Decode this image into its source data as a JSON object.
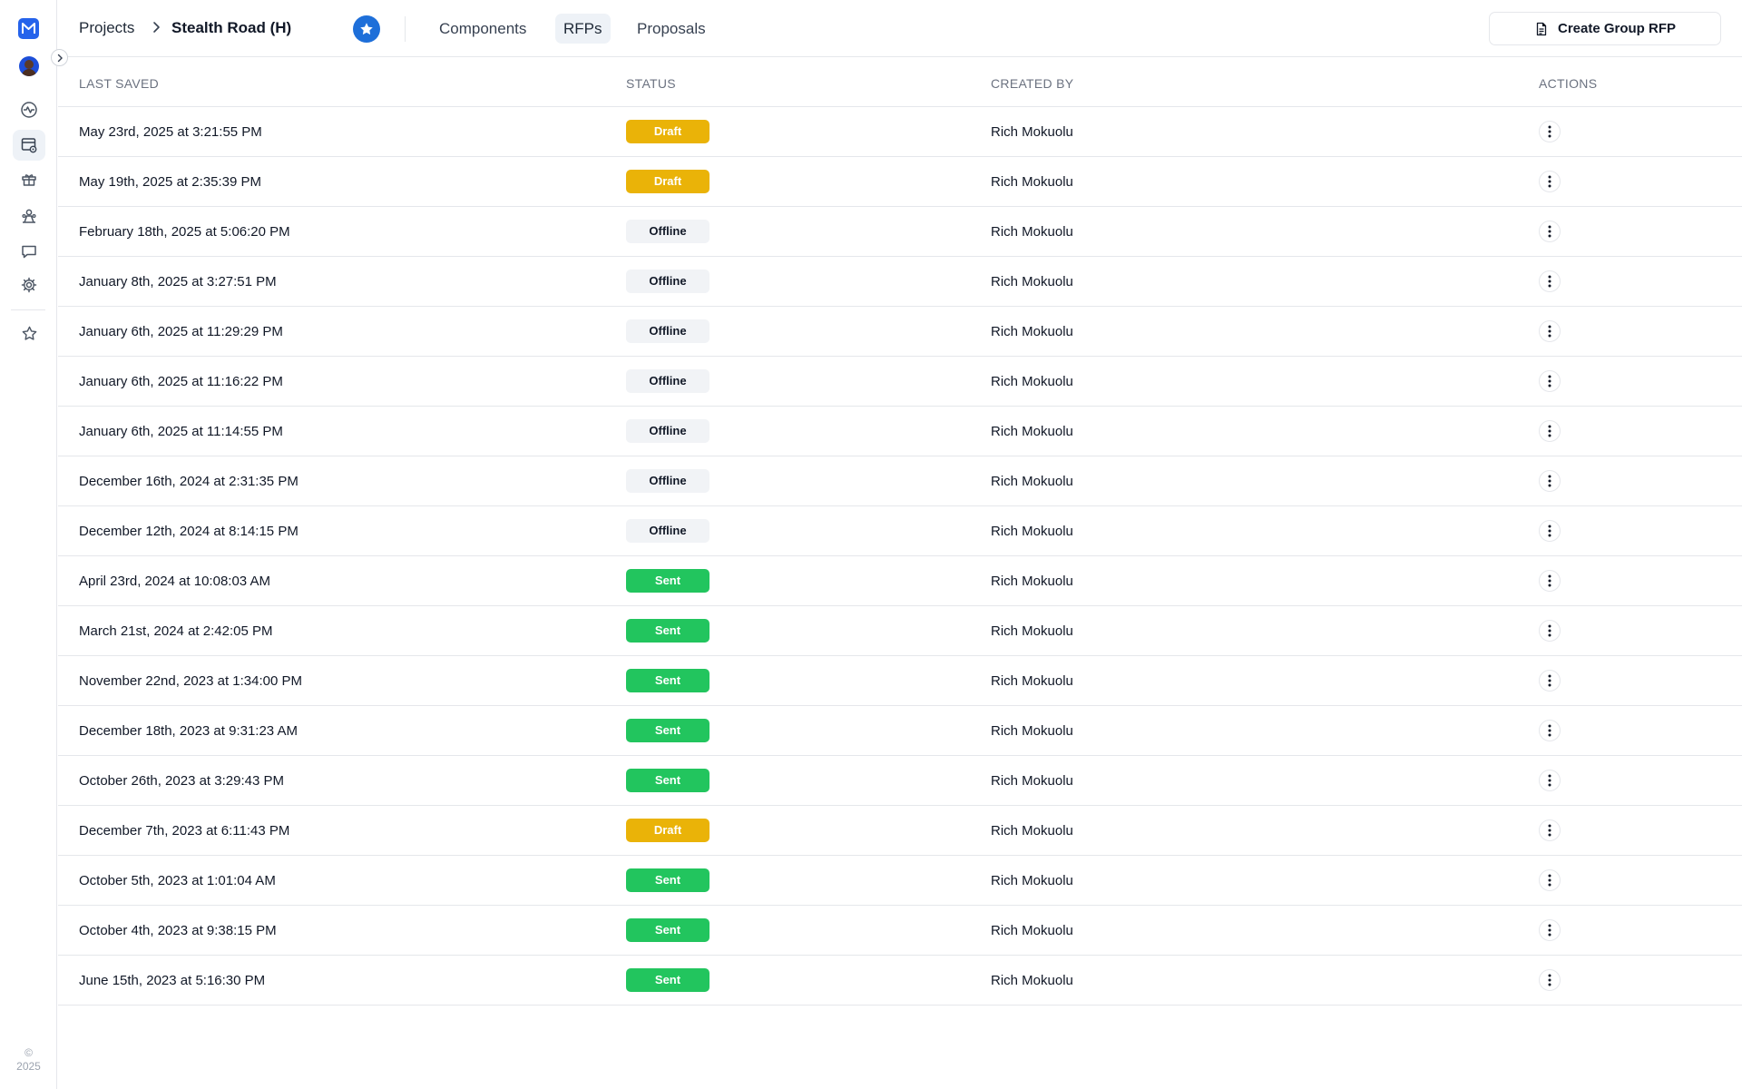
{
  "app": {
    "copyright_symbol": "©",
    "copyright_year": "2025",
    "colors": {
      "accent": "#2563eb",
      "draft": "#eab308",
      "sent": "#22c55e",
      "offline": "#f1f3f6"
    }
  },
  "rail": {
    "items": [
      {
        "name": "activity-icon"
      },
      {
        "name": "rfp-browser-icon",
        "active": true
      },
      {
        "name": "components-icon"
      },
      {
        "name": "team-icon"
      },
      {
        "name": "chat-icon"
      },
      {
        "name": "settings-icon"
      },
      {
        "name": "favorites-star-icon"
      }
    ]
  },
  "header": {
    "breadcrumb_root": "Projects",
    "breadcrumb_current": "Stealth Road (H)",
    "tabs": [
      {
        "label": "Components",
        "active": false
      },
      {
        "label": "RFPs",
        "active": true
      },
      {
        "label": "Proposals",
        "active": false
      }
    ],
    "create_button_label": "Create Group RFP"
  },
  "table": {
    "columns": [
      "LAST SAVED",
      "STATUS",
      "CREATED BY",
      "ACTIONS"
    ],
    "rows": [
      {
        "last_saved": "May 23rd, 2025 at 3:21:55 PM",
        "status": "Draft",
        "created_by": "Rich Mokuolu"
      },
      {
        "last_saved": "May 19th, 2025 at 2:35:39 PM",
        "status": "Draft",
        "created_by": "Rich Mokuolu"
      },
      {
        "last_saved": "February 18th, 2025 at 5:06:20 PM",
        "status": "Offline",
        "created_by": "Rich Mokuolu"
      },
      {
        "last_saved": "January 8th, 2025 at 3:27:51 PM",
        "status": "Offline",
        "created_by": "Rich Mokuolu"
      },
      {
        "last_saved": "January 6th, 2025 at 11:29:29 PM",
        "status": "Offline",
        "created_by": "Rich Mokuolu"
      },
      {
        "last_saved": "January 6th, 2025 at 11:16:22 PM",
        "status": "Offline",
        "created_by": "Rich Mokuolu"
      },
      {
        "last_saved": "January 6th, 2025 at 11:14:55 PM",
        "status": "Offline",
        "created_by": "Rich Mokuolu"
      },
      {
        "last_saved": "December 16th, 2024 at 2:31:35 PM",
        "status": "Offline",
        "created_by": "Rich Mokuolu"
      },
      {
        "last_saved": "December 12th, 2024 at 8:14:15 PM",
        "status": "Offline",
        "created_by": "Rich Mokuolu"
      },
      {
        "last_saved": "April 23rd, 2024 at 10:08:03 AM",
        "status": "Sent",
        "created_by": "Rich Mokuolu"
      },
      {
        "last_saved": "March 21st, 2024 at 2:42:05 PM",
        "status": "Sent",
        "created_by": "Rich Mokuolu"
      },
      {
        "last_saved": "November 22nd, 2023 at 1:34:00 PM",
        "status": "Sent",
        "created_by": "Rich Mokuolu"
      },
      {
        "last_saved": "December 18th, 2023 at 9:31:23 AM",
        "status": "Sent",
        "created_by": "Rich Mokuolu"
      },
      {
        "last_saved": "October 26th, 2023 at 3:29:43 PM",
        "status": "Sent",
        "created_by": "Rich Mokuolu"
      },
      {
        "last_saved": "December 7th, 2023 at 6:11:43 PM",
        "status": "Draft",
        "created_by": "Rich Mokuolu"
      },
      {
        "last_saved": "October 5th, 2023 at 1:01:04 AM",
        "status": "Sent",
        "created_by": "Rich Mokuolu"
      },
      {
        "last_saved": "October 4th, 2023 at 9:38:15 PM",
        "status": "Sent",
        "created_by": "Rich Mokuolu"
      },
      {
        "last_saved": "June 15th, 2023 at 5:16:30 PM",
        "status": "Sent",
        "created_by": "Rich Mokuolu"
      }
    ]
  }
}
